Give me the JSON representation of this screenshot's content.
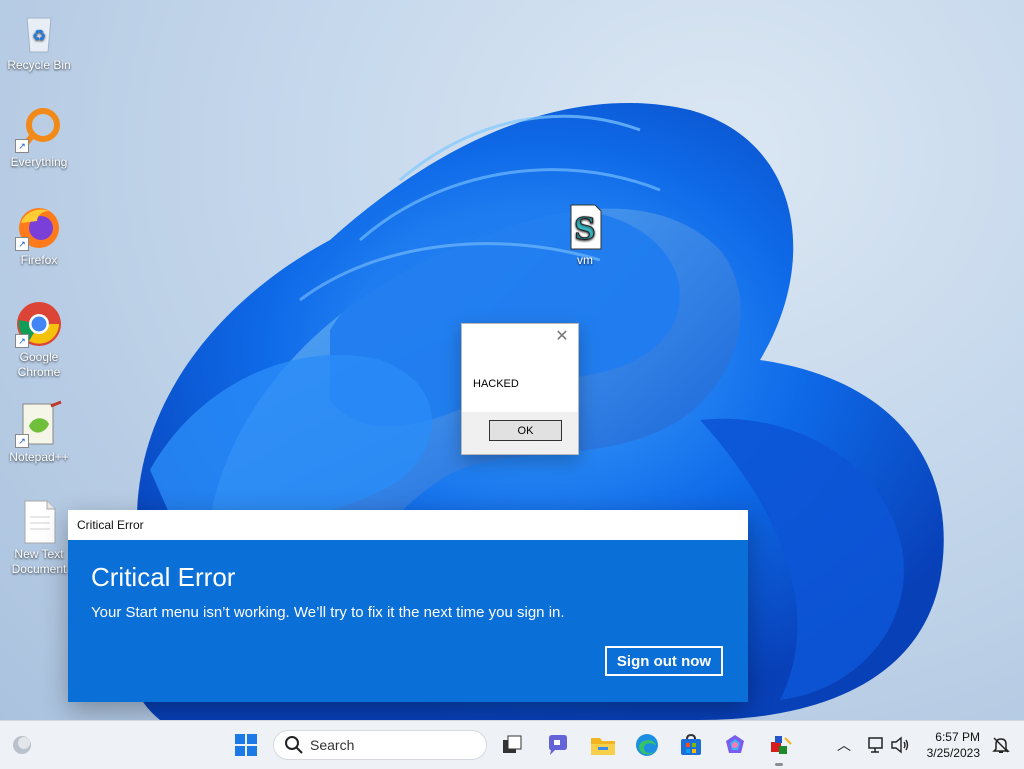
{
  "desktop": {
    "icons": [
      {
        "label": "Recycle Bin"
      },
      {
        "label": "Everything"
      },
      {
        "label": "Firefox"
      },
      {
        "label": "Google Chrome"
      },
      {
        "label": "Notepad++"
      },
      {
        "label": "New Text Document"
      },
      {
        "label": "vm"
      }
    ]
  },
  "msgbox": {
    "message": "HACKED",
    "ok_label": "OK",
    "close_glyph": "✕"
  },
  "critical_error": {
    "window_title": "Critical Error",
    "heading": "Critical Error",
    "message": "Your Start menu isn’t working. We’ll try to fix it the next time you sign in.",
    "sign_out_label": "Sign out now",
    "accent_color": "#0a6fd6"
  },
  "taskbar": {
    "search_placeholder": "Search",
    "clock": {
      "time": "6:57 PM",
      "date": "3/25/2023"
    },
    "apps": [
      "start-icon",
      "task-view-icon",
      "teams-chat-icon",
      "file-explorer-icon",
      "edge-icon",
      "store-icon",
      "copilot-icon",
      "app-icon"
    ]
  }
}
